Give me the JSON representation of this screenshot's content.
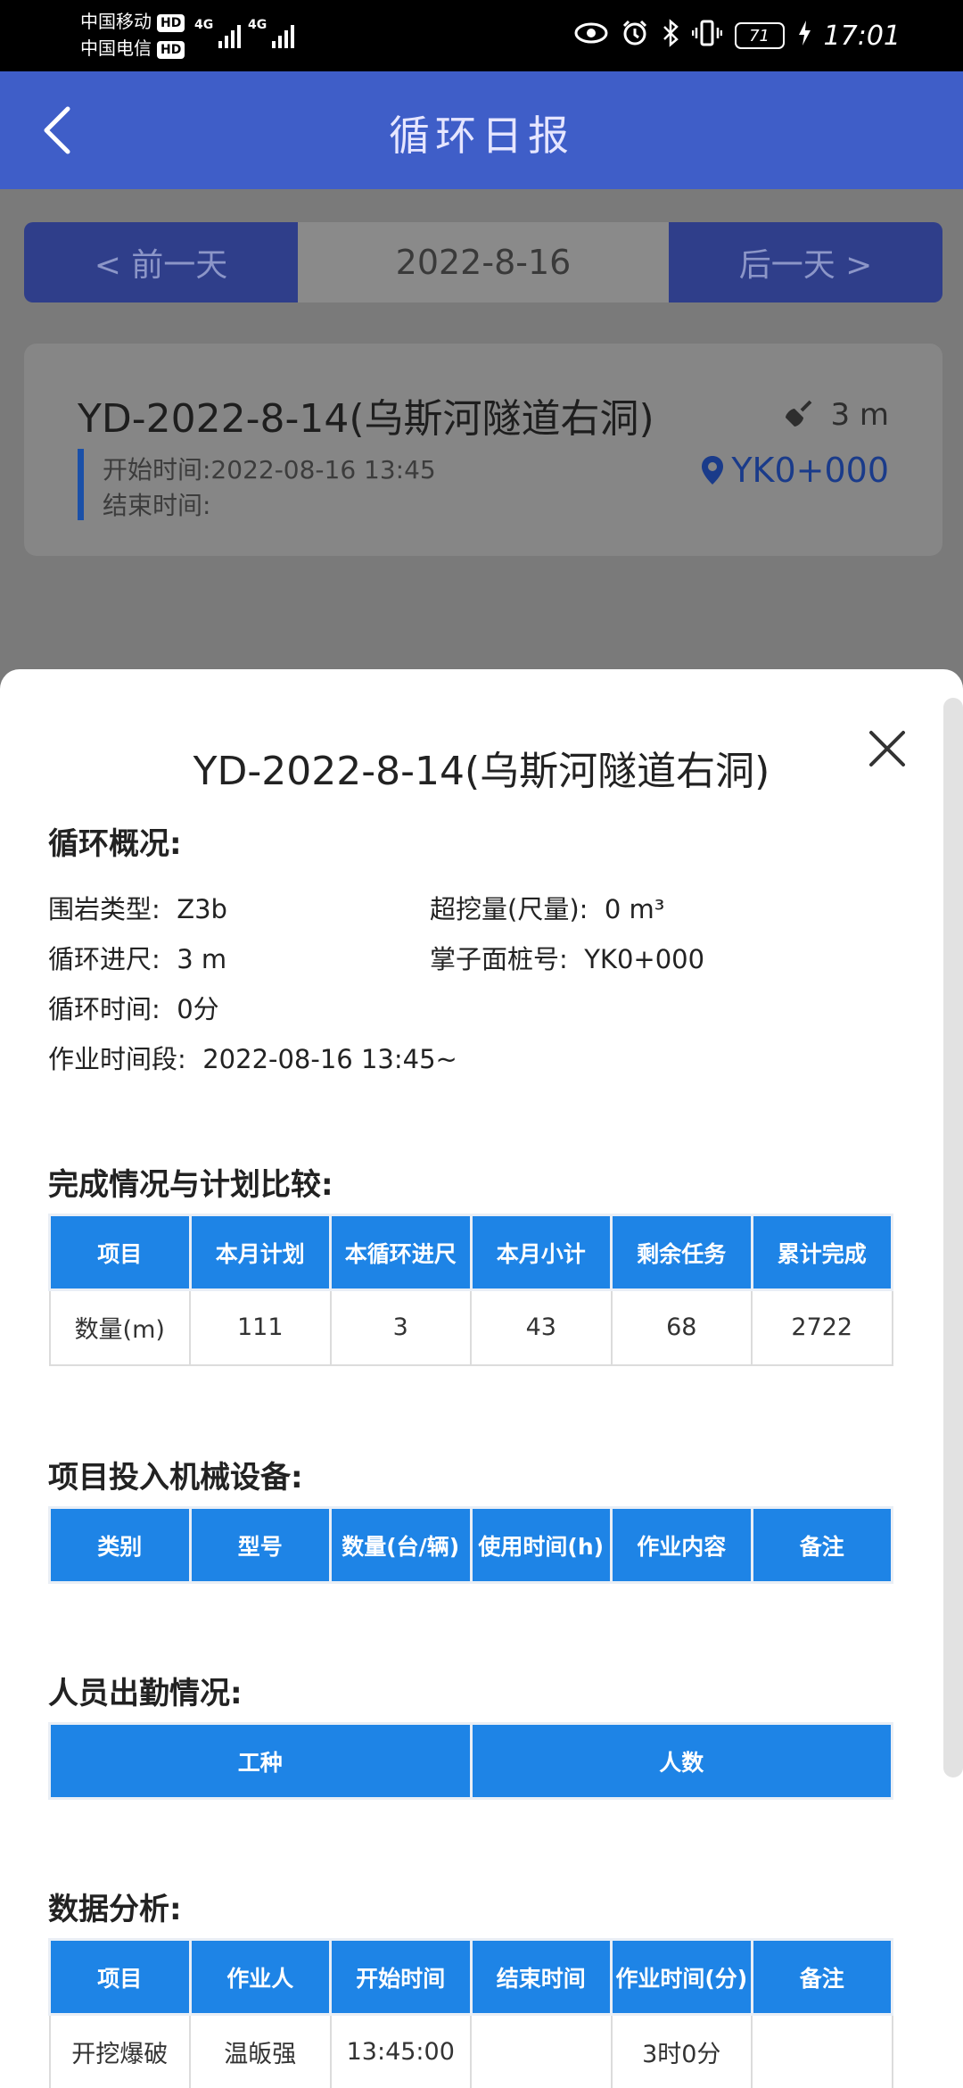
{
  "status_bar": {
    "carrier1": "中国移动",
    "carrier2": "中国电信",
    "hd": "HD",
    "net": "4G",
    "battery": "71",
    "time": "17:01"
  },
  "app_bar": {
    "title": "循环日报"
  },
  "date_nav": {
    "prev": "< 前一天",
    "date": "2022-8-16",
    "next": "后一天 >"
  },
  "card": {
    "name": "YD-2022-8-14(乌斯河隧道右洞)",
    "start": "开始时间:2022-08-16 13:45",
    "end": "结束时间:",
    "length": "3 m",
    "location": "YK0+000"
  },
  "sheet": {
    "title": "YD-2022-8-14(乌斯河隧道右洞)",
    "overview": {
      "heading": "循环概况:",
      "rock_label": "围岩类型:",
      "rock_value": "Z3b",
      "overbreak_label": "超挖量(尺量):",
      "overbreak_value": "0 m³",
      "advance_label": "循环进尺:",
      "advance_value": "3 m",
      "face_label": "掌子面桩号:",
      "face_value": "YK0+000",
      "cycle_time_label": "循环时间:",
      "cycle_time_value": "0分",
      "period_label": "作业时间段:",
      "period_value": "2022-08-16 13:45~"
    },
    "completion": {
      "heading": "完成情况与计划比较:",
      "headers": [
        "项目",
        "本月计划",
        "本循环进尺",
        "本月小计",
        "剩余任务",
        "累计完成"
      ],
      "row": [
        "数量(m)",
        "111",
        "3",
        "43",
        "68",
        "2722"
      ]
    },
    "equipment": {
      "heading": "项目投入机械设备:",
      "headers": [
        "类别",
        "型号",
        "数量(台/辆)",
        "使用时间(h)",
        "作业内容",
        "备注"
      ]
    },
    "attendance": {
      "heading": "人员出勤情况:",
      "headers": [
        "工种",
        "人数"
      ]
    },
    "analysis": {
      "heading": "数据分析:",
      "headers": [
        "项目",
        "作业人",
        "开始时间",
        "结束时间",
        "作业时间(分)",
        "备注"
      ],
      "row": [
        "开挖爆破",
        "温皈强",
        "13:45:00",
        "",
        "3时0分",
        ""
      ]
    }
  }
}
